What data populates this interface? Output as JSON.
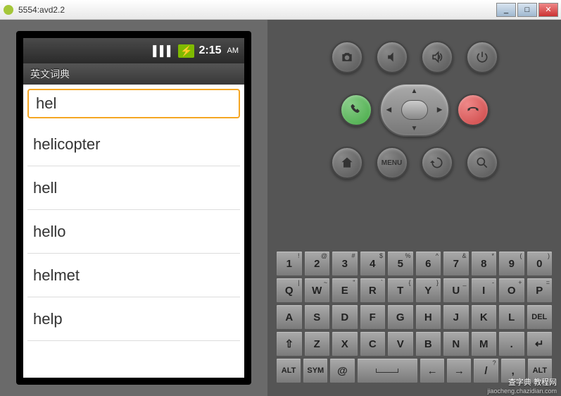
{
  "window": {
    "title": "5554:avd2.2",
    "min": "_",
    "max": "□",
    "close": "✕"
  },
  "statusbar": {
    "signal": "▌▌▌",
    "time": "2:15",
    "ampm": "AM"
  },
  "app": {
    "title": "英文词典",
    "search_value": "hel",
    "results": [
      "helicopter",
      "hell",
      "hello",
      "helmet",
      "help"
    ]
  },
  "controls": {
    "menu_label": "MENU"
  },
  "keyboard": {
    "row1": [
      {
        "k": "1",
        "s": "!"
      },
      {
        "k": "2",
        "s": "@"
      },
      {
        "k": "3",
        "s": "#"
      },
      {
        "k": "4",
        "s": "$"
      },
      {
        "k": "5",
        "s": "%"
      },
      {
        "k": "6",
        "s": "^"
      },
      {
        "k": "7",
        "s": "&"
      },
      {
        "k": "8",
        "s": "*"
      },
      {
        "k": "9",
        "s": "("
      },
      {
        "k": "0",
        "s": ")"
      }
    ],
    "row2": [
      {
        "k": "Q",
        "s": "|"
      },
      {
        "k": "W",
        "s": "~"
      },
      {
        "k": "E",
        "s": "\""
      },
      {
        "k": "R",
        "s": "`"
      },
      {
        "k": "T",
        "s": "{"
      },
      {
        "k": "Y",
        "s": "}"
      },
      {
        "k": "U",
        "s": "_"
      },
      {
        "k": "I",
        "s": "-"
      },
      {
        "k": "O",
        "s": "+"
      },
      {
        "k": "P",
        "s": "="
      }
    ],
    "row3": [
      {
        "k": "A"
      },
      {
        "k": "S"
      },
      {
        "k": "D"
      },
      {
        "k": "F"
      },
      {
        "k": "G"
      },
      {
        "k": "H"
      },
      {
        "k": "J"
      },
      {
        "k": "K"
      },
      {
        "k": "L"
      },
      {
        "k": "DEL",
        "del": true
      }
    ],
    "row4": [
      {
        "k": "⇧"
      },
      {
        "k": "Z"
      },
      {
        "k": "X"
      },
      {
        "k": "C"
      },
      {
        "k": "V"
      },
      {
        "k": "B"
      },
      {
        "k": "N"
      },
      {
        "k": "M"
      },
      {
        "k": "."
      },
      {
        "k": "↵"
      }
    ],
    "row5": {
      "alt": "ALT",
      "sym": "SYM",
      "at": "@",
      "slash": "/",
      "slash_sup": "?",
      "comma": ",",
      "alt2": "ALT"
    }
  },
  "watermark": {
    "main": "查字典 教程网",
    "sub": "jiaocheng.chazidian.com"
  }
}
